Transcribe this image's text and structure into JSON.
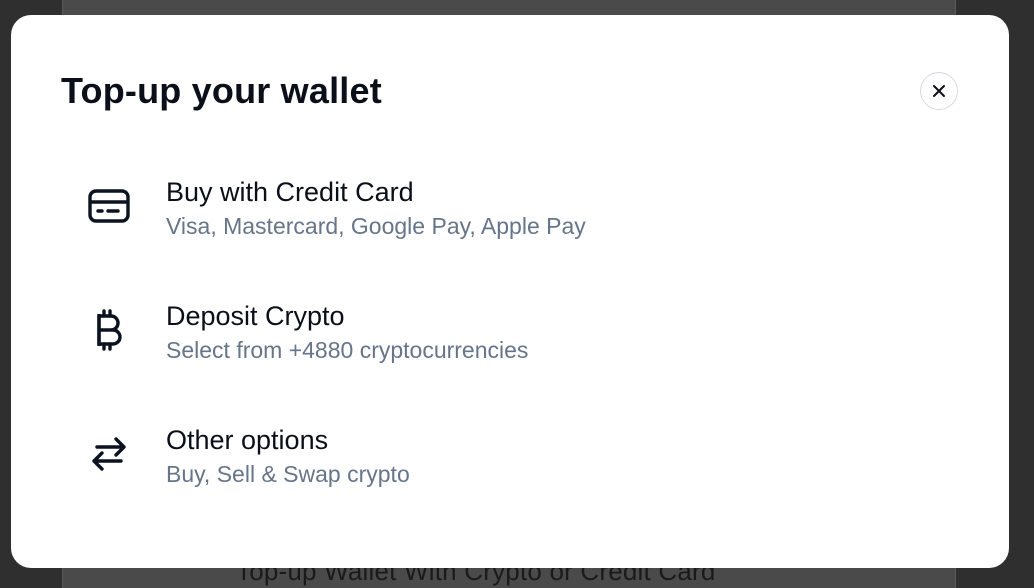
{
  "background": {
    "heading": "Top-up Wallet With Crypto or Credit Card"
  },
  "modal": {
    "title": "Top-up your wallet",
    "close_icon": "close-icon",
    "options": [
      {
        "icon": "credit-card-icon",
        "title": "Buy with Credit Card",
        "subtitle": "Visa, Mastercard, Google Pay, Apple Pay"
      },
      {
        "icon": "bitcoin-icon",
        "title": "Deposit Crypto",
        "subtitle": "Select from +4880 cryptocurrencies"
      },
      {
        "icon": "swap-arrows-icon",
        "title": "Other options",
        "subtitle": "Buy, Sell & Swap crypto"
      }
    ]
  },
  "colors": {
    "title_text": "#0b0f1a",
    "subtitle_text": "#66758a",
    "overlay": "#2f2f2f",
    "modal_bg": "#ffffff"
  }
}
